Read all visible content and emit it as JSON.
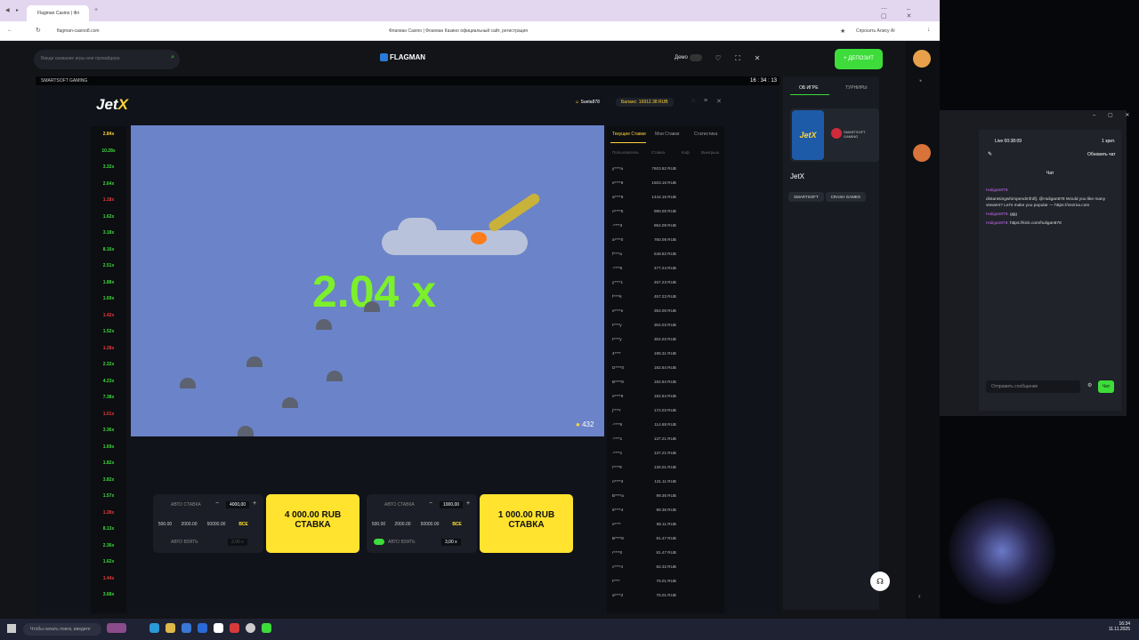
{
  "browser": {
    "tab_title": "Flagman Casino | Фл",
    "url": "flagman-casino8.com",
    "page_title": "Флагман Casino | Флагман Казино официальный сайт, регистрация",
    "ask_ai": "Спросить Алису AI"
  },
  "site": {
    "search_placeholder": "Введи название игры или провайдера",
    "logo": "FLAGMAN",
    "demo_label": "Демо",
    "deposit_label": "+ ДЕПОЗИТ"
  },
  "game": {
    "provider_bar": "SMARTSOFT GAMING",
    "time": "16 : 34 : 13",
    "title_jet": "Jet",
    "title_x": "X",
    "username": "Sueta878",
    "balance": "Баланс: 16912.38 RUB",
    "multiplier": "2.04 x",
    "players": "432",
    "history": [
      {
        "v": "2.84x",
        "c": "#ffd43b"
      },
      {
        "v": "10.28x",
        "c": "#3ddc3a"
      },
      {
        "v": "3.32x",
        "c": "#3ddc3a"
      },
      {
        "v": "2.64x",
        "c": "#3ddc3a"
      },
      {
        "v": "1.18x",
        "c": "#e83b3b"
      },
      {
        "v": "1.62x",
        "c": "#3ddc3a"
      },
      {
        "v": "3.18x",
        "c": "#3ddc3a"
      },
      {
        "v": "8.16x",
        "c": "#3ddc3a"
      },
      {
        "v": "2.51x",
        "c": "#3ddc3a"
      },
      {
        "v": "1.88x",
        "c": "#3ddc3a"
      },
      {
        "v": "1.69x",
        "c": "#3ddc3a"
      },
      {
        "v": "1.42x",
        "c": "#e83b3b"
      },
      {
        "v": "1.52x",
        "c": "#3ddc3a"
      },
      {
        "v": "1.28x",
        "c": "#e83b3b"
      },
      {
        "v": "2.32x",
        "c": "#3ddc3a"
      },
      {
        "v": "4.23x",
        "c": "#3ddc3a"
      },
      {
        "v": "7.38x",
        "c": "#3ddc3a"
      },
      {
        "v": "1.01x",
        "c": "#e83b3b"
      },
      {
        "v": "3.36x",
        "c": "#3ddc3a"
      },
      {
        "v": "1.69x",
        "c": "#3ddc3a"
      },
      {
        "v": "1.82x",
        "c": "#3ddc3a"
      },
      {
        "v": "3.82x",
        "c": "#3ddc3a"
      },
      {
        "v": "1.57x",
        "c": "#3ddc3a"
      },
      {
        "v": "1.28x",
        "c": "#e83b3b"
      },
      {
        "v": "8.13x",
        "c": "#3ddc3a"
      },
      {
        "v": "2.36x",
        "c": "#3ddc3a"
      },
      {
        "v": "1.62x",
        "c": "#3ddc3a"
      },
      {
        "v": "1.44x",
        "c": "#e83b3b"
      },
      {
        "v": "3.68x",
        "c": "#3ddc3a"
      }
    ],
    "bet1": {
      "auto_bet": "АВТО СТАВКА",
      "amount": "4000,00",
      "quick": [
        "500.00",
        "2000.00",
        "50000.00"
      ],
      "all": "ВСЕ",
      "auto_cash": "АВТО ВЗЯТЬ",
      "cash_value": "2,00 x",
      "button_amount": "4 000.00 RUB",
      "button_label": "СТАВКА"
    },
    "bet2": {
      "auto_bet": "АВТО СТАВКА",
      "amount": "1000,00",
      "quick": [
        "500.00",
        "2000.00",
        "50000.00"
      ],
      "all": "ВСЕ",
      "auto_cash": "АВТО ВЗЯТЬ",
      "cash_value": "3,00 x",
      "button_amount": "1 000.00 RUB",
      "button_label": "СТАВКА"
    },
    "bets_tabs": [
      "Текущие Ставки",
      "Мои Ставки",
      "Статистика"
    ],
    "bets_header": [
      "Пользователь",
      "Ставка",
      "Кэф",
      "Выигрыш"
    ],
    "bets": [
      [
        "y****a",
        "7603.82 RUB"
      ],
      [
        "e****9",
        "1503.16 RUB"
      ],
      [
        "a****9",
        "1444.16 RUB"
      ],
      [
        "n****6",
        "990.00 RUB"
      ],
      [
        "-****3",
        "954.09 RUB"
      ],
      [
        "a****0",
        "760.08 RUB"
      ],
      [
        "f****a",
        "548.82 RUB"
      ],
      [
        "-****5",
        "477.24 RUB"
      ],
      [
        "y****1",
        "457.23 RUB"
      ],
      [
        "f****k",
        "457.23 RUB"
      ],
      [
        "e****e",
        "354.00 RUB"
      ],
      [
        "t****y",
        "304.03 RUB"
      ],
      [
        "t****y",
        "304.03 RUB"
      ],
      [
        "4****",
        "198.31 RUB"
      ],
      [
        "D****0",
        "182.84 RUB"
      ],
      [
        "B****8",
        "182.84 RUB"
      ],
      [
        "e****9",
        "182.84 RUB"
      ],
      [
        "j****r",
        "172.03 RUB"
      ],
      [
        "-****5",
        "114.88 RUB"
      ],
      [
        "-****1",
        "137.21 RUB"
      ],
      [
        "-****1",
        "137.21 RUB"
      ],
      [
        "i****9",
        "136.01 RUB"
      ],
      [
        "n****3",
        "131.11 RUB"
      ],
      [
        "B****a",
        "99.36 RUB"
      ],
      [
        "5****4",
        "99.36 RUB"
      ],
      [
        "e****",
        "86.11 RUB"
      ],
      [
        "B****8",
        "81.47 RUB"
      ],
      [
        "r****0",
        "81.47 RUB"
      ],
      [
        "c****4",
        "82.32 RUB"
      ],
      [
        "t****",
        "76.01 RUB"
      ],
      [
        "a****2",
        "76.01 RUB"
      ]
    ]
  },
  "side": {
    "tab1": "ОБ ИГРЕ",
    "tab2": "ТУРНИРЫ",
    "game_name": "JetX",
    "provider_logo": "SMARTSOFT GAMING",
    "chip1": "SMARTSOFT",
    "chip2": "CRASH GAMES"
  },
  "stream": {
    "live": "Live 00:38:09",
    "viewers": "1 зрит.",
    "refresh": "Обновить чат",
    "chat_title": "Чат",
    "messages": [
      {
        "user": "Huligan878:",
        "text": ""
      },
      {
        "user": "",
        "text": "distantsingwhimpendmfrdfj: @Huligan878 Would you like many viewers? Let's make you popular — https://nezma.com"
      },
      {
        "user": "Huligan878:",
        "text": "ggg"
      },
      {
        "user": "Huligan878:",
        "text": "https://kick.com/huligan878"
      }
    ],
    "input_placeholder": "Отправить сообщение",
    "send": "Чат"
  },
  "taskbar": {
    "search": "Чтобы начать поиск, введите",
    "time": "16:34",
    "date": "11.11.2025"
  }
}
